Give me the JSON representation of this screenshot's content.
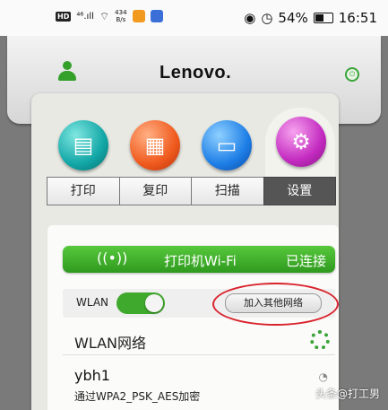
{
  "status_bar": {
    "hd": "HD",
    "signal": "⁴⁶.ıll",
    "speed_value": "434",
    "speed_unit": "B/s",
    "battery_percent": "54%",
    "time": "16:51"
  },
  "header": {
    "brand": "Lenovo."
  },
  "tabs": [
    {
      "label": "打印"
    },
    {
      "label": "复印"
    },
    {
      "label": "扫描"
    },
    {
      "label": "设置"
    }
  ],
  "wifi": {
    "title": "打印机Wi-Fi",
    "status": "已连接"
  },
  "wlan": {
    "label": "WLAN",
    "enabled": true,
    "add_button": "加入其他网络"
  },
  "networks": {
    "header": "WLAN网络",
    "items": [
      {
        "ssid": "ybh1",
        "security": "通过WPA2_PSK_AES加密"
      }
    ]
  },
  "watermark": "头条@打工男",
  "colors": {
    "green": "#3fa92d",
    "highlight_ring": "#d9232d",
    "active_tab": "#555555"
  },
  "icons": [
    "user-icon",
    "power-icon",
    "print-icon",
    "copy-icon",
    "scan-icon",
    "settings-gear-icon",
    "wifi-icon",
    "spinner-icon",
    "wifi-signal-icon"
  ]
}
